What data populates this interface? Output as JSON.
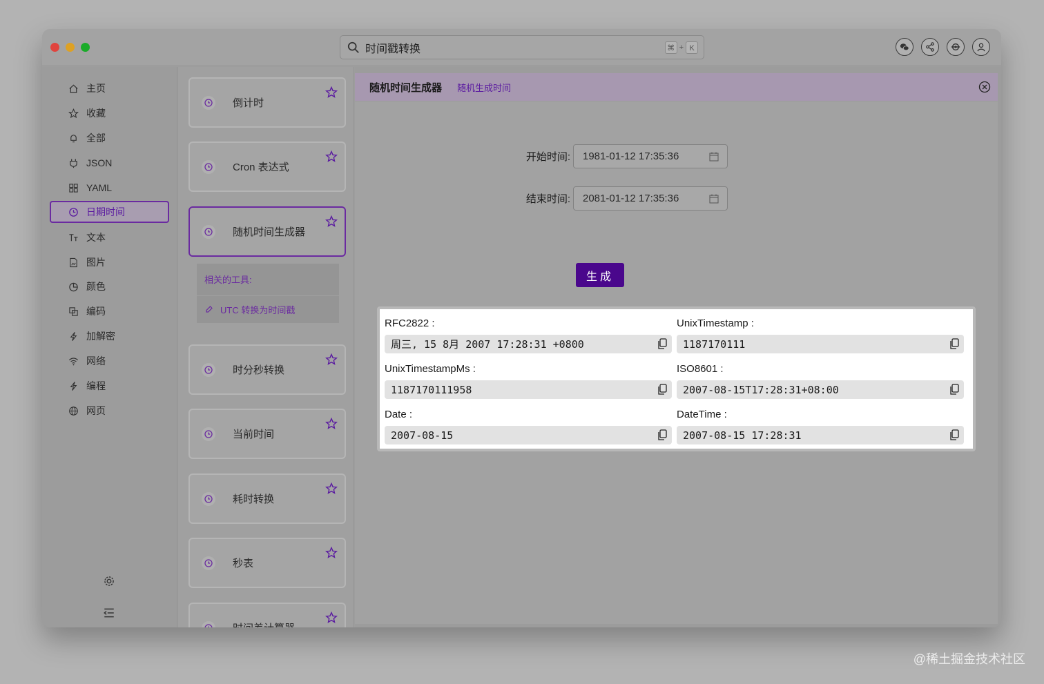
{
  "search": {
    "text": "时间戳转换",
    "shortcut_mod": "⌘",
    "shortcut_plus": "+",
    "shortcut_key": "K"
  },
  "header_icons": [
    "wechat-icon",
    "share-icon",
    "settings-sync-icon",
    "user-icon"
  ],
  "sidebar": {
    "items": [
      {
        "label": "主页",
        "icon": "home-icon"
      },
      {
        "label": "收藏",
        "icon": "star-icon"
      },
      {
        "label": "全部",
        "icon": "bell-icon"
      },
      {
        "label": "JSON",
        "icon": "plug-icon"
      },
      {
        "label": "YAML",
        "icon": "grid-icon"
      },
      {
        "label": "日期时间",
        "icon": "clock-icon",
        "active": true
      },
      {
        "label": "文本",
        "icon": "text-icon"
      },
      {
        "label": "图片",
        "icon": "image-icon"
      },
      {
        "label": "颜色",
        "icon": "pie-icon"
      },
      {
        "label": "编码",
        "icon": "copy-icon"
      },
      {
        "label": "加解密",
        "icon": "bolt-icon"
      },
      {
        "label": "网络",
        "icon": "wifi-icon"
      },
      {
        "label": "编程",
        "icon": "bolt-icon"
      },
      {
        "label": "网页",
        "icon": "globe-icon"
      }
    ]
  },
  "tools": {
    "cards": [
      {
        "label": "倒计时"
      },
      {
        "label": "Cron 表达式"
      },
      {
        "label": "随机时间生成器",
        "active": true
      },
      {
        "label": "时分秒转换"
      },
      {
        "label": "当前时间"
      },
      {
        "label": "耗时转换"
      },
      {
        "label": "秒表"
      },
      {
        "label": "时间差计算器"
      }
    ],
    "related_title": "相关的工具:",
    "related_item": "UTC 转换为时间戳"
  },
  "main": {
    "title": "随机时间生成器",
    "subtitle": "随机生成时间",
    "start_label": "开始时间:",
    "start_value": "1981-01-12 17:35:36",
    "end_label": "结束时间:",
    "end_value": "2081-01-12 17:35:36",
    "generate_label": "生成",
    "results": [
      {
        "label": "RFC2822 :",
        "value": "周三, 15 8月 2007 17:28:31 +0800"
      },
      {
        "label": "UnixTimestamp :",
        "value": "1187170111"
      },
      {
        "label": "UnixTimestampMs :",
        "value": "1187170111958"
      },
      {
        "label": "ISO8601 :",
        "value": "2007-08-15T17:28:31+08:00"
      },
      {
        "label": "Date :",
        "value": "2007-08-15"
      },
      {
        "label": "DateTime :",
        "value": "2007-08-15 17:28:31"
      }
    ]
  },
  "watermark": "@稀土掘金技术社区",
  "colors": {
    "accent": "#4a078c",
    "active_border": "#6a2aa0",
    "tab_bar": "#a798b0"
  }
}
